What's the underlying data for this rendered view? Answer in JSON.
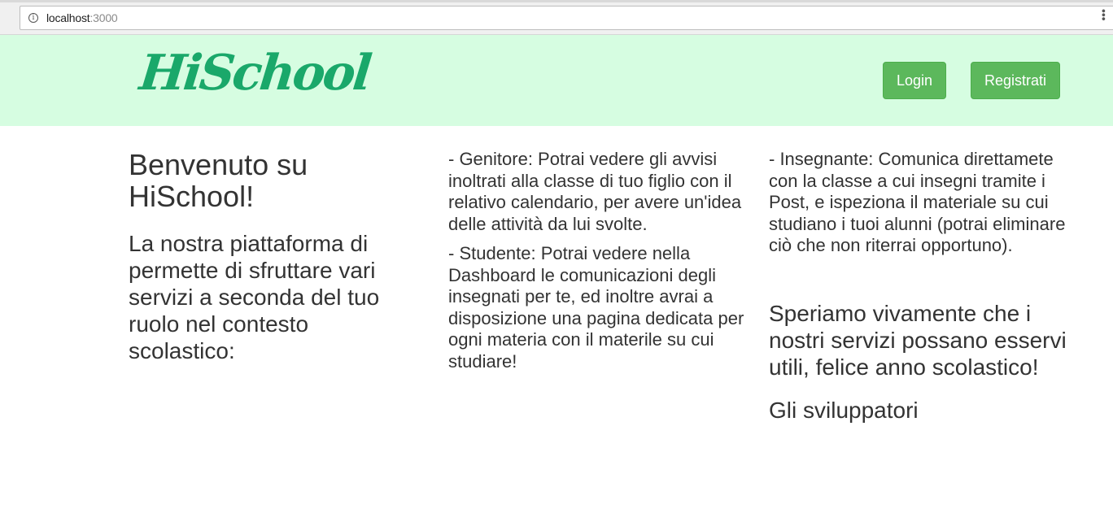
{
  "browser": {
    "url_host": "localhost",
    "url_port": ":3000"
  },
  "header": {
    "logo_text": "HiSchool",
    "login_label": "Login",
    "register_label": "Registrati",
    "background_color": "#d6fde1",
    "logo_color": "#1aa86a",
    "button_color": "#5cb85c"
  },
  "content": {
    "welcome_title": "Benvenuto su HiSchool!",
    "intro": "La nostra piattaforma di permette di sfruttare vari servizi a seconda del tuo ruolo nel contesto scolastico:",
    "genitore": "- Genitore: Potrai vedere gli avvisi inoltrati alla classe di tuo figlio con il relativo calendario, per avere un'idea delle attività da lui svolte.",
    "studente": "- Studente: Potrai vedere nella Dashboard le comunicazioni degli insegnati per te, ed inoltre avrai a disposizione una pagina dedicata per ogni materia con il materile su cui studiare!",
    "insegnante": "- Insegnante: Comunica direttamete con la classe a cui insegni tramite i Post, e ispeziona il materiale su cui studiano i tuoi alunni (potrai eliminare ciò che non riterrai opportuno).",
    "closing": "Speriamo vivamente che i nostri servizi possano esservi utili, felice anno scolastico!",
    "signature": "Gli sviluppatori"
  }
}
